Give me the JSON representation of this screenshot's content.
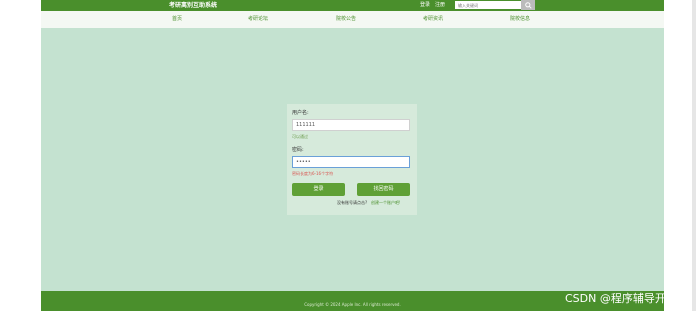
{
  "header": {
    "site_title": "考研离别互助系统",
    "login_label": "登录",
    "register_label": "注册",
    "search_placeholder": "输入关键词"
  },
  "nav": {
    "items": [
      "首页",
      "考研论坛",
      "院校公告",
      "考研资讯",
      "院校信息"
    ]
  },
  "form": {
    "username_label": "用户名:",
    "username_value": "111111",
    "username_hint": "可以通过",
    "password_label": "密码:",
    "password_value": "•••••",
    "password_error": "密码长度为6-16个字符",
    "login_button": "登录",
    "retrieve_button": "找回密码",
    "no_account_text": "没有账号请点击?",
    "create_account_link": "创建一个账户吧!"
  },
  "footer": {
    "copyright": "Copyright © 2024 Apple Inc. All rights reserved."
  },
  "watermark": "CSDN @程序辅导开发",
  "colors": {
    "brand_green": "#4a8f2c",
    "button_green": "#5fa036",
    "page_bg": "#c4e2d0",
    "error_red": "#d9534f"
  }
}
